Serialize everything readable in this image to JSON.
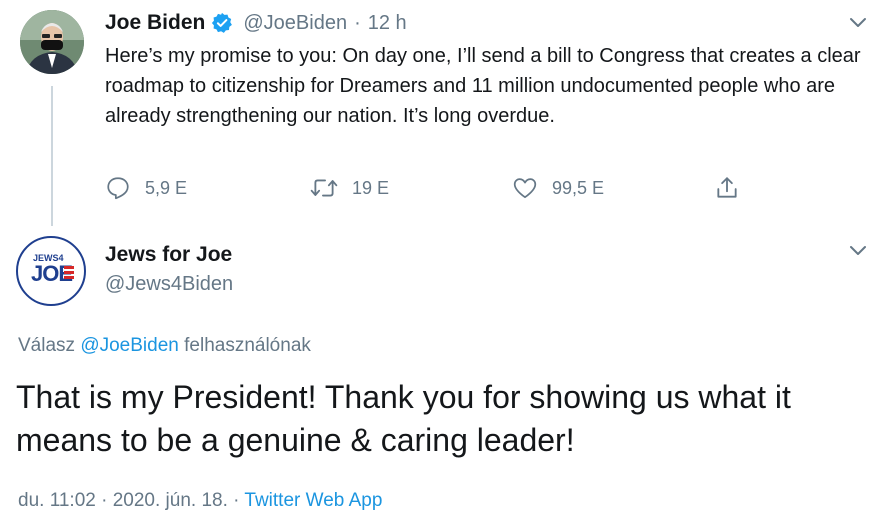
{
  "parent_tweet": {
    "author_name": "Joe Biden",
    "handle": "@JoeBiden",
    "separator": "·",
    "time": "12 h",
    "text": "Here’s my promise to you: On day one, I’ll send a bill to Congress that creates a clear roadmap to citizenship for Dreamers and 11 million undocumented people who are already strengthening our nation. It’s long overdue.",
    "actions": {
      "replies": "5,9 E",
      "retweets": "19 E",
      "likes": "99,5 E"
    }
  },
  "reply_tweet": {
    "author_name": "Jews for Joe",
    "handle": "@Jews4Biden",
    "logo_text": {
      "top": "JEWS4",
      "main": "JOE"
    },
    "replying_to_prefix": "Válasz",
    "replying_to_handle": "@JoeBiden",
    "replying_to_suffix": "felhasználónak",
    "text": "That is my President! Thank you for showing us what it means to be a genuine & caring leader!",
    "timestamp": "du. 11:02 · 2020. jún. 18. ·",
    "source": "Twitter Web App"
  },
  "colors": {
    "verified": "#1da1f2",
    "link": "#1b95e0",
    "muted": "#657786"
  }
}
